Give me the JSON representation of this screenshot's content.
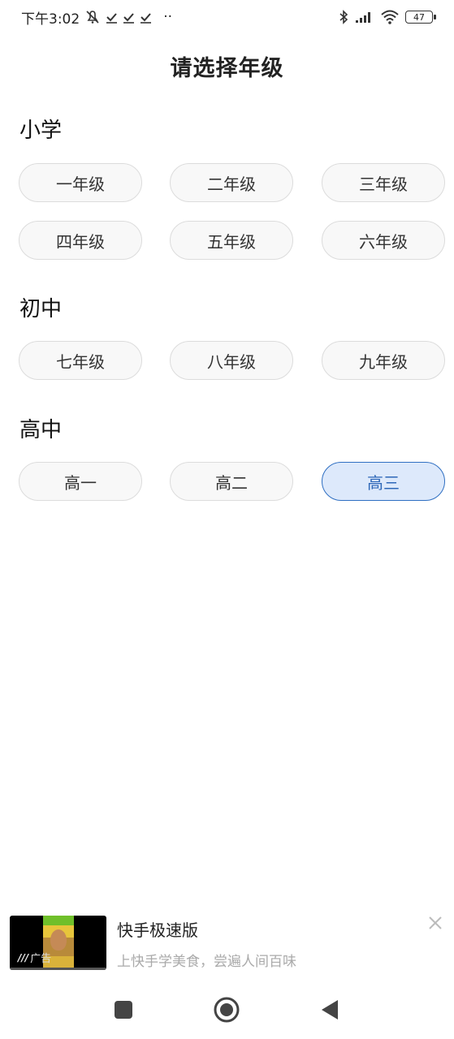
{
  "status_bar": {
    "time": "下午3:02",
    "dots": "··",
    "battery": "47"
  },
  "page": {
    "title": "请选择年级"
  },
  "sections": [
    {
      "title": "小学",
      "grades": [
        "一年级",
        "二年级",
        "三年级",
        "四年级",
        "五年级",
        "六年级"
      ]
    },
    {
      "title": "初中",
      "grades": [
        "七年级",
        "八年级",
        "九年级"
      ]
    },
    {
      "title": "高中",
      "grades": [
        "高一",
        "高二",
        "高三"
      ]
    }
  ],
  "selected_grade": "高三",
  "colors": {
    "selected_bg": "#dde9fb",
    "selected_border": "#2f6fc2",
    "selected_text": "#2d67b8"
  },
  "ad": {
    "title": "快手极速版",
    "description": "上快手学美食，尝遍人间百味",
    "badge": "广告"
  },
  "nav": {
    "icons": [
      "square-icon",
      "circle-home-icon",
      "back-triangle-icon"
    ]
  }
}
